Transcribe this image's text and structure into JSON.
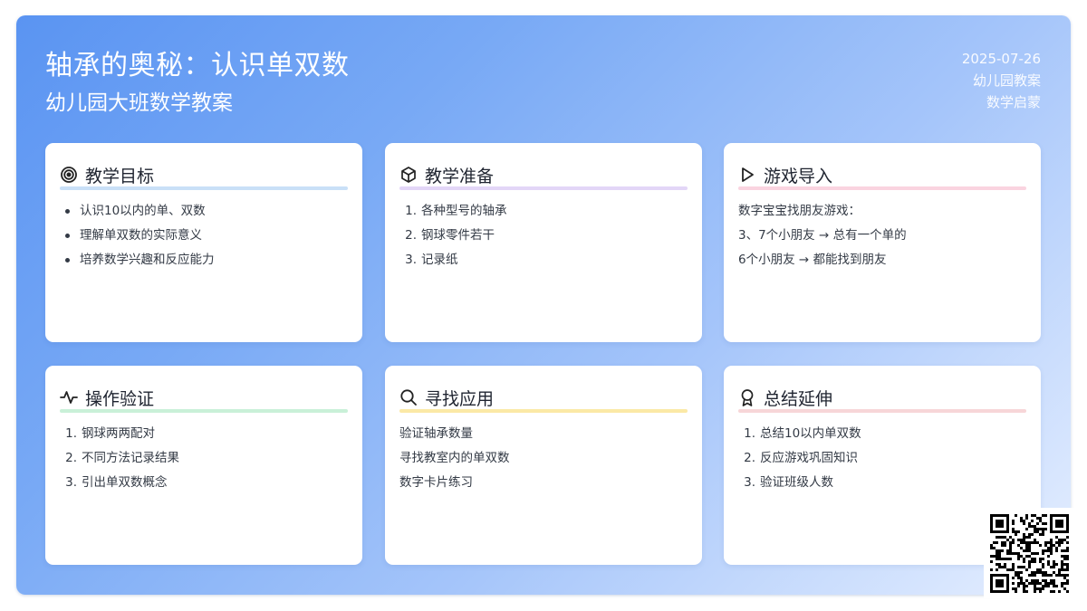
{
  "header": {
    "title": "轴承的奥秘：认识单双数",
    "subtitle": "幼儿园大班数学教案",
    "date": "2025-07-26",
    "category": "幼儿园教案",
    "tag": "数学启蒙"
  },
  "cards": [
    {
      "title": "教学目标",
      "icon": "target-icon",
      "accent": "#c9e0f7",
      "list_style": "bullet",
      "items": [
        "认识10以内的单、双数",
        "理解单双数的实际意义",
        "培养数学兴趣和反应能力"
      ]
    },
    {
      "title": "教学准备",
      "icon": "cube-icon",
      "accent": "#e3d6f7",
      "list_style": "numbered",
      "markers": [
        "1.",
        "2.",
        "3."
      ],
      "items": [
        "各种型号的轴承",
        "钢球零件若干",
        "记录纸"
      ]
    },
    {
      "title": "游戏导入",
      "icon": "play-icon",
      "accent": "#fad4e0",
      "list_style": "plain",
      "items": [
        "数字宝宝找朋友游戏：",
        "3、7个小朋友 → 总有一个单的",
        "6个小朋友 → 都能找到朋友"
      ]
    },
    {
      "title": "操作验证",
      "icon": "activity-icon",
      "accent": "#c9f0d8",
      "list_style": "numbered",
      "markers": [
        "1.",
        "2.",
        "3."
      ],
      "items": [
        "钢球两两配对",
        "不同方法记录结果",
        "引出单双数概念"
      ]
    },
    {
      "title": "寻找应用",
      "icon": "search-icon",
      "accent": "#fbe9a6",
      "list_style": "plain",
      "items": [
        "验证轴承数量",
        "寻找教室内的单双数",
        "数字卡片练习"
      ]
    },
    {
      "title": "总结延伸",
      "icon": "award-icon",
      "accent": "#f7d6d8",
      "list_style": "numbered",
      "markers": [
        "1.",
        "2.",
        "3."
      ],
      "items": [
        "总结10以内单双数",
        "反应游戏巩固知识",
        "验证班级人数"
      ]
    }
  ],
  "qr_code": {
    "icon": "qr-code-icon"
  }
}
